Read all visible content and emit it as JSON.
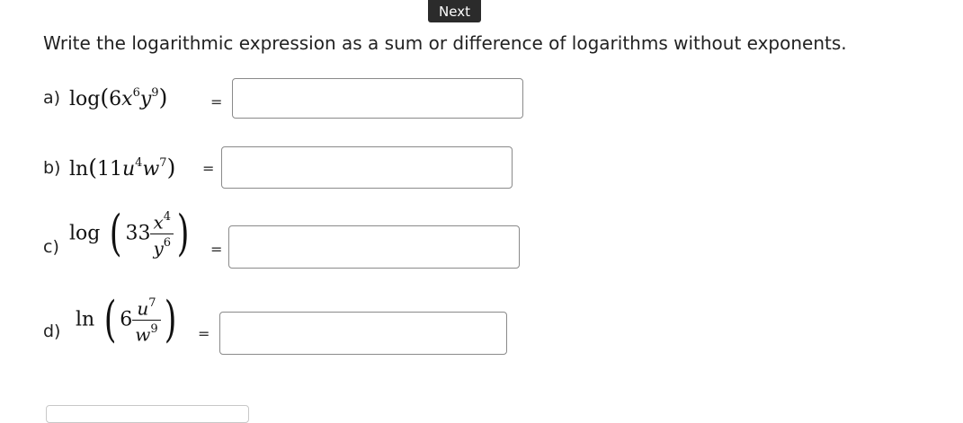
{
  "toolbar": {
    "next_label": "Next"
  },
  "instructions": "Write the logarithmic expression as a sum or difference of logarithms without exponents.",
  "parts": [
    {
      "label": "a)",
      "fn": "log",
      "coef": "6",
      "v1": "x",
      "e1": "6",
      "v2": "y",
      "e2": "9",
      "equals": "=",
      "answer": ""
    },
    {
      "label": "b)",
      "fn": "ln",
      "coef": "11",
      "v1": "u",
      "e1": "4",
      "v2": "w",
      "e2": "7",
      "equals": "=",
      "answer": ""
    },
    {
      "label": "c)",
      "fn": "log",
      "coef": "33",
      "num_var": "x",
      "num_exp": "4",
      "den_var": "y",
      "den_exp": "6",
      "equals": "=",
      "answer": ""
    },
    {
      "label": "d)",
      "fn": "ln",
      "coef": "6",
      "num_var": "u",
      "num_exp": "7",
      "den_var": "w",
      "den_exp": "9",
      "equals": "=",
      "answer": ""
    }
  ]
}
